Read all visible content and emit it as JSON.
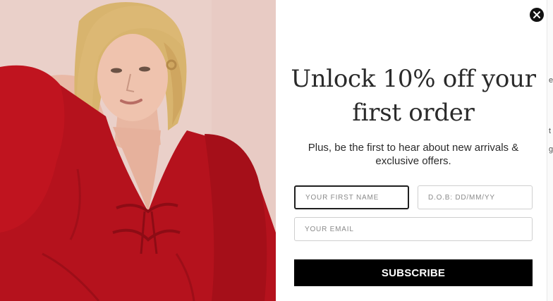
{
  "popup": {
    "headline": "Unlock 10% off your first order",
    "subtext": "Plus, be the first to hear about new arrivals & exclusive offers.",
    "close_icon": "close-icon",
    "fields": {
      "first_name": {
        "placeholder": "YOUR FIRST NAME",
        "value": ""
      },
      "dob": {
        "placeholder": "D.O.B: DD/MM/YY",
        "value": ""
      },
      "email": {
        "placeholder": "YOUR EMAIL",
        "value": ""
      }
    },
    "subscribe_label": "SUBSCRIBE"
  },
  "background_fragments": [
    "e",
    "t",
    "g"
  ],
  "colors": {
    "button_bg": "#000000",
    "close_bg": "#111111",
    "headline_text": "#2a2a2a",
    "dress_red": "#b5121d"
  }
}
